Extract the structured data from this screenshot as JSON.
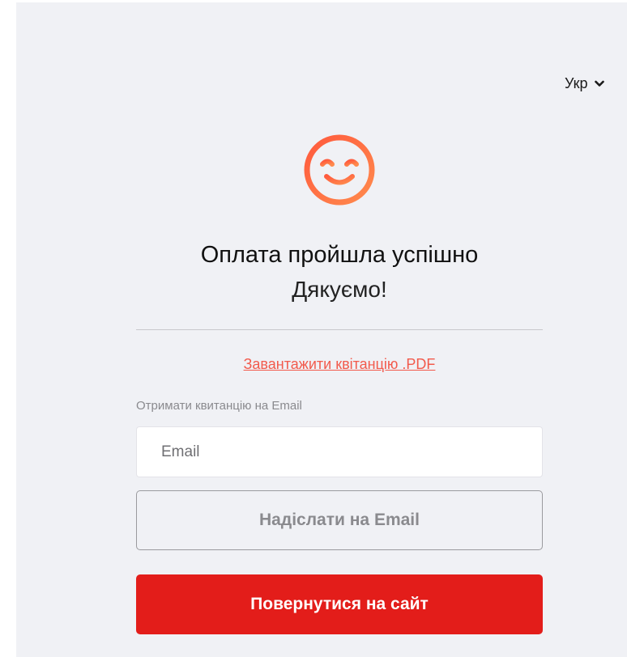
{
  "language": {
    "selected": "Укр",
    "icon": "chevron-down-icon"
  },
  "status": {
    "icon": "smiley-face-icon",
    "title": "Оплата пройшла успішно",
    "subtitle": "Дякуємо!"
  },
  "receipt": {
    "download_link": "Завантажити квітанцію .PDF",
    "email_label": "Отримати квитанцію на Email",
    "email_placeholder": "Email",
    "email_value": "",
    "send_button": "Надіслати на Email"
  },
  "return_button": "Повернутися на сайт",
  "colors": {
    "accent_red": "#e31d1a",
    "smiley_gradient_start": "#ff5a3d",
    "smiley_gradient_end": "#ff8a4d",
    "link": "#f25a4c",
    "panel_background": "#f0f1f5"
  }
}
